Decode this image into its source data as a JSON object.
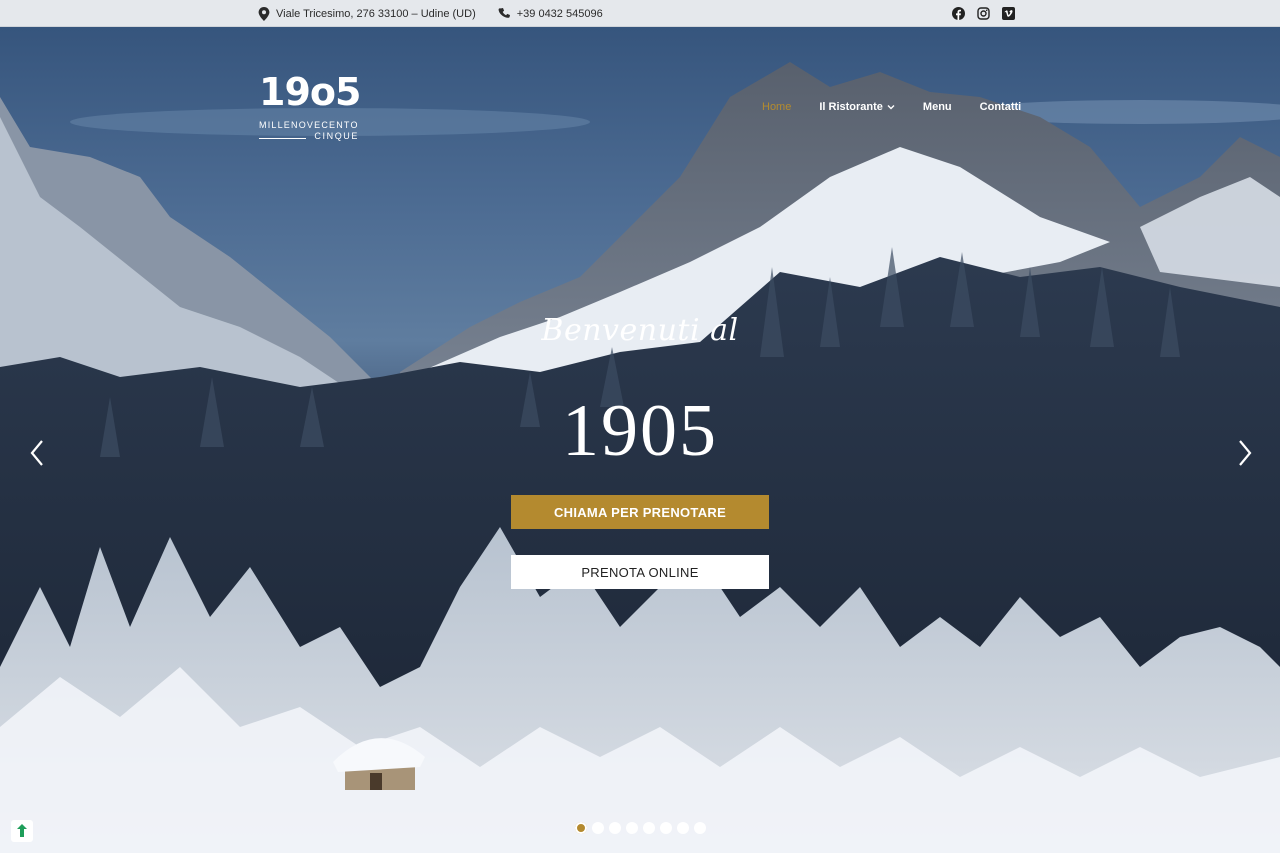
{
  "topbar": {
    "address": "Viale Tricesimo, 276 33100 – Udine (UD)",
    "phone": "+39 0432 545096",
    "icons": [
      "location-pin-icon",
      "phone-icon"
    ],
    "social": [
      "facebook-icon",
      "instagram-icon",
      "vimeo-icon"
    ]
  },
  "logo": {
    "number": "19o5",
    "line1": "MILLENOVECENTO",
    "line2": "CINQUE"
  },
  "nav": {
    "items": [
      {
        "label": "Home",
        "active": true
      },
      {
        "label": "Il Ristorante",
        "dropdown": true
      },
      {
        "label": "Menu"
      },
      {
        "label": "Contatti"
      }
    ]
  },
  "hero": {
    "welcome": "Benvenuti al",
    "year": "1905",
    "call_button": "CHIAMA PER PRENOTARE",
    "book_button": "PRENOTA ONLINE",
    "slide_count": 8,
    "active_slide": 1
  },
  "colors": {
    "accent": "#b48a2f",
    "topbar_bg": "#e5e8ec",
    "white": "#ffffff"
  }
}
